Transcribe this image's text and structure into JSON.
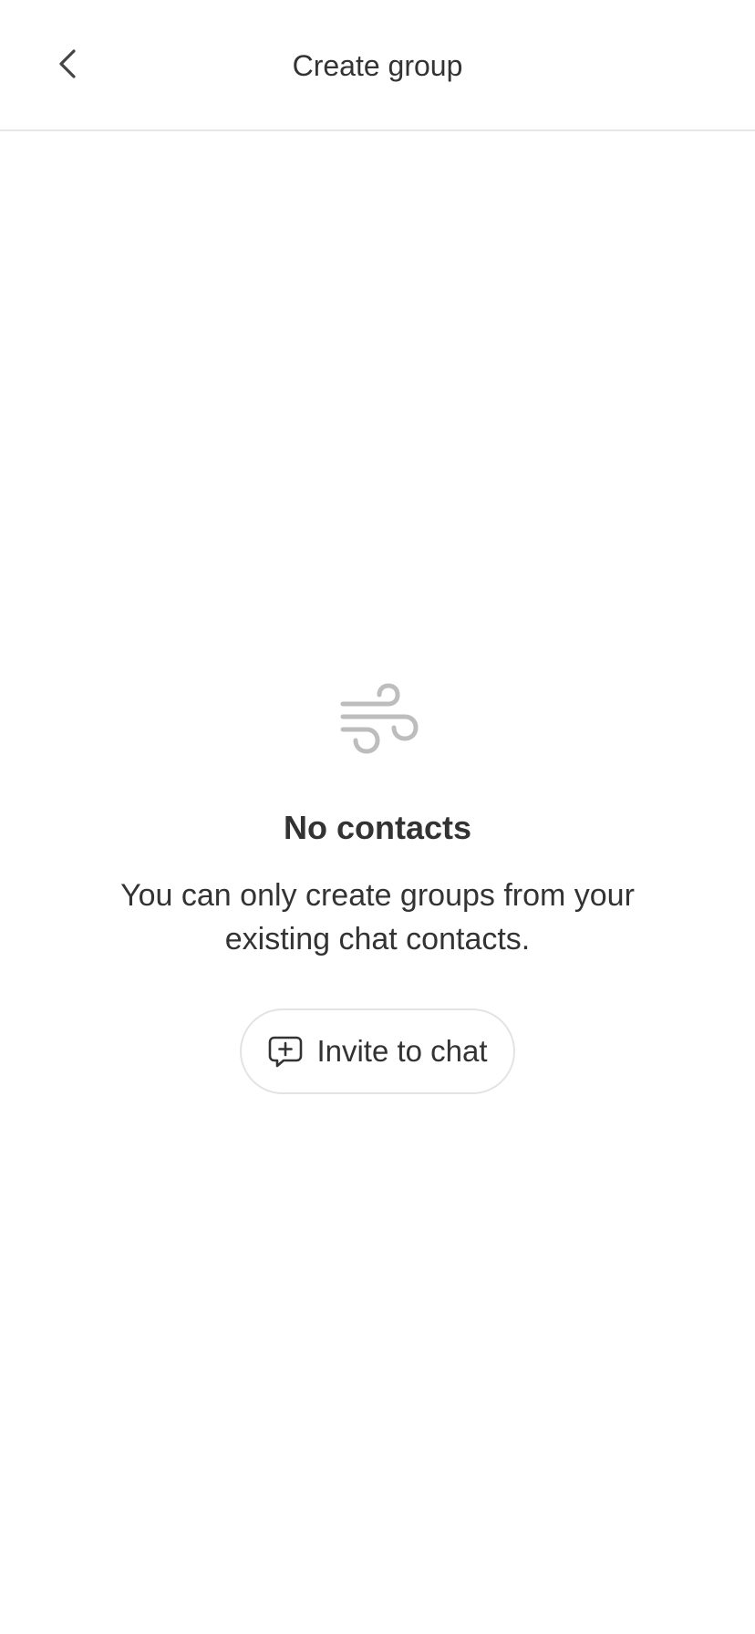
{
  "header": {
    "title": "Create group",
    "back_icon": "chevron-left-icon"
  },
  "empty_state": {
    "icon": "wind-icon",
    "title": "No contacts",
    "description": "You can only create groups from your existing chat contacts.",
    "invite_button": {
      "label": "Invite to chat",
      "icon": "chat-plus-icon"
    }
  },
  "colors": {
    "text": "#333333",
    "divider": "#e6e6e6",
    "icon_muted": "#bdbdbd",
    "button_border": "#e3e3e3",
    "background": "#ffffff"
  }
}
